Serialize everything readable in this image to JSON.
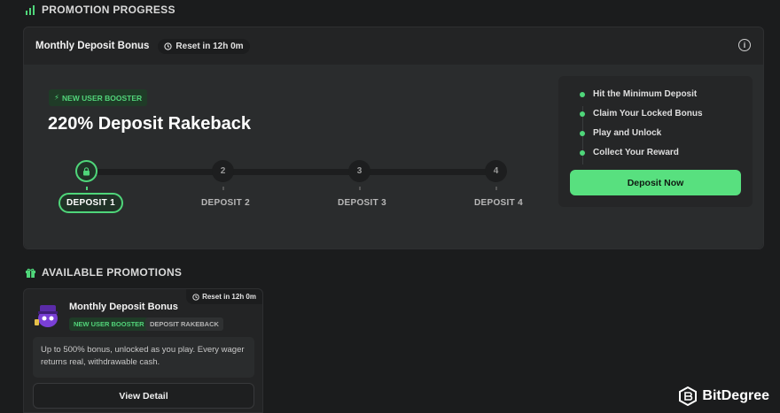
{
  "progress_section": {
    "header": "PROMOTION PROGRESS",
    "card": {
      "title": "Monthly Deposit Bonus",
      "reset": "Reset in 12h 0m",
      "badge": "NEW USER BOOSTER",
      "headline": "220% Deposit Rakeback",
      "steps": [
        {
          "number": "",
          "label": "DEPOSIT 1",
          "active": true
        },
        {
          "number": "2",
          "label": "DEPOSIT 2",
          "active": false
        },
        {
          "number": "3",
          "label": "DEPOSIT 3",
          "active": false
        },
        {
          "number": "4",
          "label": "DEPOSIT 4",
          "active": false
        }
      ],
      "checklist": [
        "Hit the Minimum Deposit",
        "Claim Your Locked Bonus",
        "Play and Unlock",
        "Collect Your Reward"
      ],
      "cta": "Deposit Now"
    }
  },
  "available_section": {
    "header": "AVAILABLE PROMOTIONS",
    "promo": {
      "reset": "Reset in 12h 0m",
      "title": "Monthly Deposit Bonus",
      "tags": [
        "NEW USER BOOSTER",
        "DEPOSIT RAKEBACK"
      ],
      "description": "Up to 500% bonus, unlocked as you play. Every wager returns real, withdrawable cash.",
      "button": "View Detail"
    }
  },
  "watermark": "BitDegree",
  "colors": {
    "accent_green": "#58e07f",
    "background": "#1b1c1d",
    "card": "#232425"
  }
}
